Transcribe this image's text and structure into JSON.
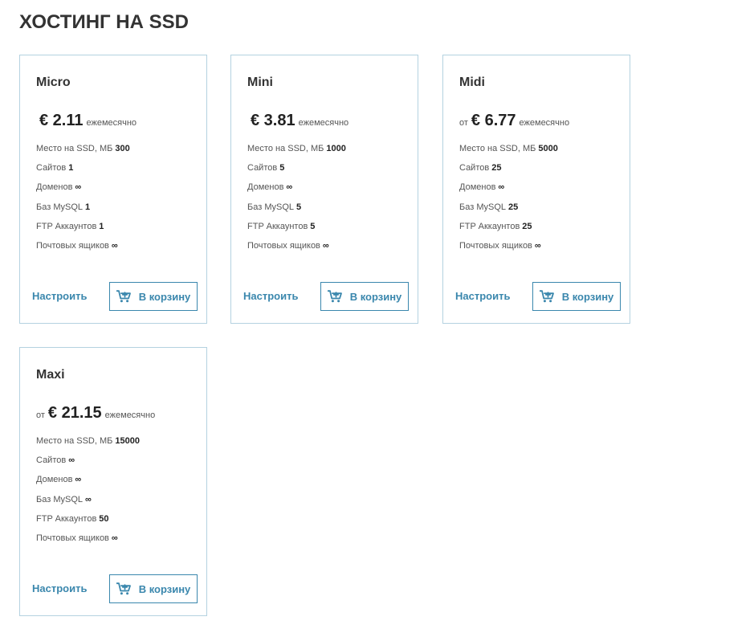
{
  "page": {
    "title": "ХОСТИНГ НА SSD"
  },
  "colors": {
    "accent": "#3a87ad",
    "card_border": "#b4d2e0",
    "text": "#333333"
  },
  "labels": {
    "disk": "Место на SSD, МБ",
    "sites": "Сайтов",
    "domains": "Доменов",
    "mysql": "Баз MySQL",
    "ftp": "FTP Аккаунтов",
    "mailboxes": "Почтовых ящиков",
    "configure": "Настроить",
    "add_to_cart": "В корзину",
    "period": "ежемесячно"
  },
  "plans": [
    {
      "name": "Micro",
      "price_prefix": "",
      "price": "€ 2.11",
      "disk": "300",
      "sites": "1",
      "domains": "∞",
      "mysql": "1",
      "ftp": "1",
      "mailboxes": "∞"
    },
    {
      "name": "Mini",
      "price_prefix": "",
      "price": "€ 3.81",
      "disk": "1000",
      "sites": "5",
      "domains": "∞",
      "mysql": "5",
      "ftp": "5",
      "mailboxes": "∞"
    },
    {
      "name": "Midi",
      "price_prefix": "от",
      "price": "€ 6.77",
      "disk": "5000",
      "sites": "25",
      "domains": "∞",
      "mysql": "25",
      "ftp": "25",
      "mailboxes": "∞"
    },
    {
      "name": "Maxi",
      "price_prefix": "от",
      "price": "€ 21.15",
      "disk": "15000",
      "sites": "∞",
      "domains": "∞",
      "mysql": "∞",
      "ftp": "50",
      "mailboxes": "∞"
    }
  ]
}
